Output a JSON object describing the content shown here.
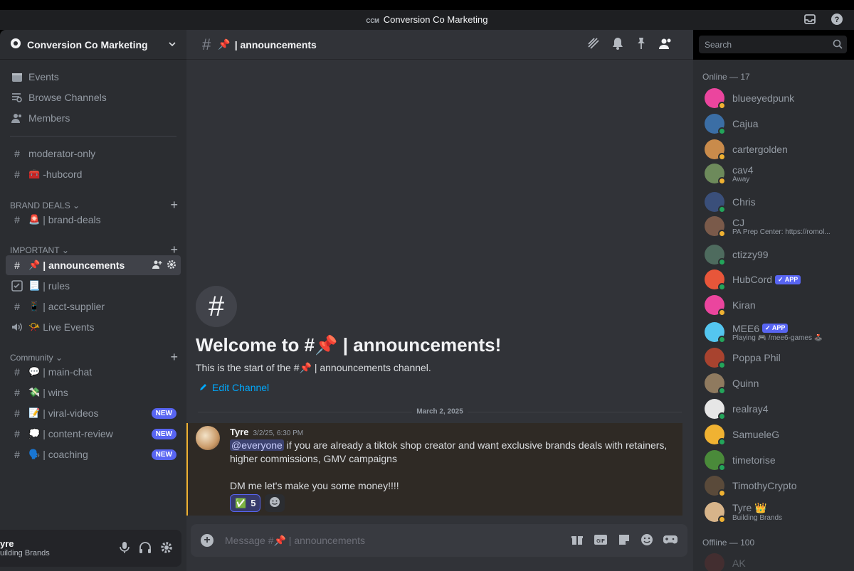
{
  "window": {
    "title": "Conversion Co Marketing",
    "server_abbrev": "CCM"
  },
  "guild": {
    "name": "Conversion Co Marketing"
  },
  "sidebar": {
    "top_items": [
      {
        "label": "Events",
        "icon": "calendar-icon"
      },
      {
        "label": "Browse Channels",
        "icon": "browse-channels-icon"
      },
      {
        "label": "Members",
        "icon": "members-icon"
      }
    ],
    "ungrouped": [
      {
        "label": "moderator-only",
        "emoji": ""
      },
      {
        "label": "-hubcord",
        "emoji": "🧰"
      }
    ],
    "categories": [
      {
        "name": "BRAND DEALS",
        "channels": [
          {
            "label": "| brand-deals",
            "emoji": "🚨"
          }
        ]
      },
      {
        "name": "IMPORTANT",
        "channels": [
          {
            "label": "| announcements",
            "emoji": "📌",
            "active": true
          },
          {
            "label": "| rules",
            "emoji": "📃"
          },
          {
            "label": "| acct-supplier",
            "emoji": "📱"
          },
          {
            "label": "Live Events",
            "emoji": "📯",
            "type": "stage"
          }
        ]
      },
      {
        "name": "Community",
        "channels": [
          {
            "label": "| main-chat",
            "emoji": "💬"
          },
          {
            "label": "| wins",
            "emoji": "💸"
          },
          {
            "label": "| viral-videos",
            "emoji": "📝",
            "badge": "NEW"
          },
          {
            "label": "| content-review",
            "emoji": "💭",
            "badge": "NEW"
          },
          {
            "label": "| coaching",
            "emoji": "🗣️",
            "badge": "NEW"
          }
        ]
      }
    ]
  },
  "user_panel": {
    "name": "yre",
    "status": "uilding Brands"
  },
  "channel": {
    "name": "| announcements",
    "emoji": "📌"
  },
  "search": {
    "placeholder": "Search"
  },
  "welcome": {
    "title": "Welcome to #📌 | announcements!",
    "subtitle": "This is the start of the #📌 | announcements channel.",
    "edit_label": "Edit Channel"
  },
  "date_divider": "March 2, 2025",
  "message": {
    "author": "Tyre",
    "timestamp": "3/2/25, 6:30 PM",
    "mention": "@everyone",
    "line1": " if you are already a tiktok shop creator and want exclusive brands deals with retainers, higher commissions, GMV campaigns",
    "line2": "DM me let's make you some money!!!!",
    "reaction_emoji": "✅",
    "reaction_count": "5"
  },
  "composer": {
    "placeholder": "Message #📌 | announcements"
  },
  "members": {
    "online_header": "Online — 17",
    "offline_header": "Offline — 100",
    "online": [
      {
        "name": "blueeyedpunk",
        "sub": "",
        "color": "#eb459e",
        "status": "#f0b232"
      },
      {
        "name": "Cajua",
        "sub": "",
        "color": "#3b6ea5",
        "status": "#23a55a"
      },
      {
        "name": "cartergolden",
        "sub": "",
        "color": "#c98b4b",
        "status": "#f0b232"
      },
      {
        "name": "cav4",
        "sub": "Away",
        "color": "#6d8a5b",
        "status": "#f0b232"
      },
      {
        "name": "Chris",
        "sub": "",
        "color": "#3a4f7a",
        "status": "#23a55a"
      },
      {
        "name": "CJ",
        "sub": "PA Prep Center: https://romol...",
        "color": "#7a5a4a",
        "status": "#f0b232"
      },
      {
        "name": "ctizzy99",
        "sub": "",
        "color": "#4e6b5e",
        "status": "#23a55a"
      },
      {
        "name": "HubCord",
        "sub": "",
        "color": "#e8563a",
        "status": "#23a55a",
        "badge": "APP"
      },
      {
        "name": "Kiran",
        "sub": "",
        "color": "#eb459e",
        "status": "#f0b232"
      },
      {
        "name": "MEE6",
        "sub": "Playing 🎮 /mee6-games 🕹️",
        "color": "#54c6f0",
        "status": "#23a55a",
        "badge": "APP"
      },
      {
        "name": "Poppa Phil",
        "sub": "",
        "color": "#a8432f",
        "status": "#23a55a"
      },
      {
        "name": "Quinn",
        "sub": "",
        "color": "#8f7a5f",
        "status": "#23a55a"
      },
      {
        "name": "realray4",
        "sub": "",
        "color": "#e6e6e6",
        "status": "#23a55a"
      },
      {
        "name": "SamueleG",
        "sub": "",
        "color": "#f0b232",
        "status": "#23a55a"
      },
      {
        "name": "timetorise",
        "sub": "",
        "color": "#4a8a3a",
        "status": "#23a55a"
      },
      {
        "name": "TimothyCrypto",
        "sub": "",
        "color": "#5a4a3a",
        "status": "#f0b232"
      },
      {
        "name": "Tyre 👑",
        "sub": "Building Brands",
        "color": "#d7b48a",
        "status": "#f0b232"
      }
    ],
    "offline": [
      {
        "name": "AK",
        "color": "#5b3030"
      }
    ]
  }
}
